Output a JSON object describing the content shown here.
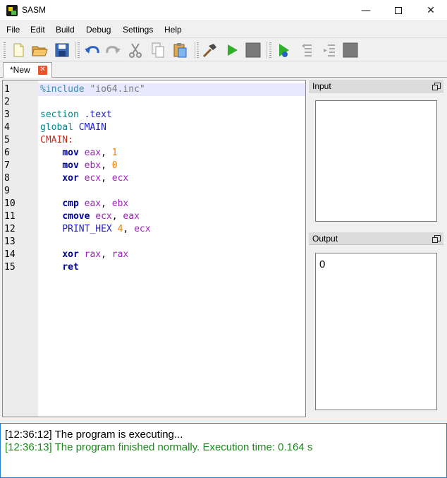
{
  "window": {
    "title": "SASM",
    "minimize_glyph": "—",
    "close_glyph": "✕"
  },
  "menu": [
    "File",
    "Edit",
    "Build",
    "Debug",
    "Settings",
    "Help"
  ],
  "toolbar": {
    "buttons": [
      "new-file-icon",
      "open-folder-icon",
      "save-icon",
      "undo-icon",
      "redo-icon",
      "cut-icon",
      "copy-icon",
      "paste-icon",
      "build-hammer-icon",
      "run-icon",
      "stop-icon",
      "debug-icon",
      "step-over-icon",
      "step-into-icon",
      "debug-stop-icon"
    ]
  },
  "tabs": [
    {
      "label": "*New",
      "close_glyph": "✕"
    }
  ],
  "editor": {
    "line_numbers": [
      "1",
      "2",
      "3",
      "4",
      "5",
      "6",
      "7",
      "8",
      "9",
      "10",
      "11",
      "12",
      "13",
      "14",
      "15"
    ],
    "lines": [
      [
        [
          "pre",
          "%include "
        ],
        [
          "str",
          "\"io64.inc\""
        ]
      ],
      [],
      [
        [
          "kw",
          "section "
        ],
        [
          "sym",
          ".text"
        ]
      ],
      [
        [
          "kw",
          "global "
        ],
        [
          "sym",
          "CMAIN"
        ]
      ],
      [
        [
          "label",
          "CMAIN:"
        ]
      ],
      [
        [
          "pl",
          "    "
        ],
        [
          "mn",
          "mov "
        ],
        [
          "reg",
          "eax"
        ],
        [
          "pl",
          ", "
        ],
        [
          "num",
          "1"
        ]
      ],
      [
        [
          "pl",
          "    "
        ],
        [
          "mn",
          "mov "
        ],
        [
          "reg",
          "ebx"
        ],
        [
          "pl",
          ", "
        ],
        [
          "num",
          "0"
        ]
      ],
      [
        [
          "pl",
          "    "
        ],
        [
          "mn",
          "xor "
        ],
        [
          "reg",
          "ecx"
        ],
        [
          "pl",
          ", "
        ],
        [
          "reg",
          "ecx"
        ]
      ],
      [],
      [
        [
          "pl",
          "    "
        ],
        [
          "mn",
          "cmp "
        ],
        [
          "reg",
          "eax"
        ],
        [
          "pl",
          ", "
        ],
        [
          "reg",
          "ebx"
        ]
      ],
      [
        [
          "pl",
          "    "
        ],
        [
          "mn",
          "cmove "
        ],
        [
          "reg",
          "ecx"
        ],
        [
          "pl",
          ", "
        ],
        [
          "reg",
          "eax"
        ]
      ],
      [
        [
          "pl",
          "    "
        ],
        [
          "mac",
          "PRINT_HEX "
        ],
        [
          "num",
          "4"
        ],
        [
          "pl",
          ", "
        ],
        [
          "reg",
          "ecx"
        ]
      ],
      [],
      [
        [
          "pl",
          "    "
        ],
        [
          "mn",
          "xor "
        ],
        [
          "reg",
          "rax"
        ],
        [
          "pl",
          ", "
        ],
        [
          "reg",
          "rax"
        ]
      ],
      [
        [
          "pl",
          "    "
        ],
        [
          "mn",
          "ret"
        ]
      ]
    ],
    "current_line": 1
  },
  "input_panel": {
    "title": "Input"
  },
  "output_panel": {
    "title": "Output",
    "text": "0"
  },
  "log": [
    {
      "time": "[12:36:12]",
      "message": "The program is executing...",
      "color": "#000000"
    },
    {
      "time": "[12:36:13]",
      "message": "The program finished normally. Execution time: 0.164 s",
      "color": "#1a8a1a"
    }
  ]
}
